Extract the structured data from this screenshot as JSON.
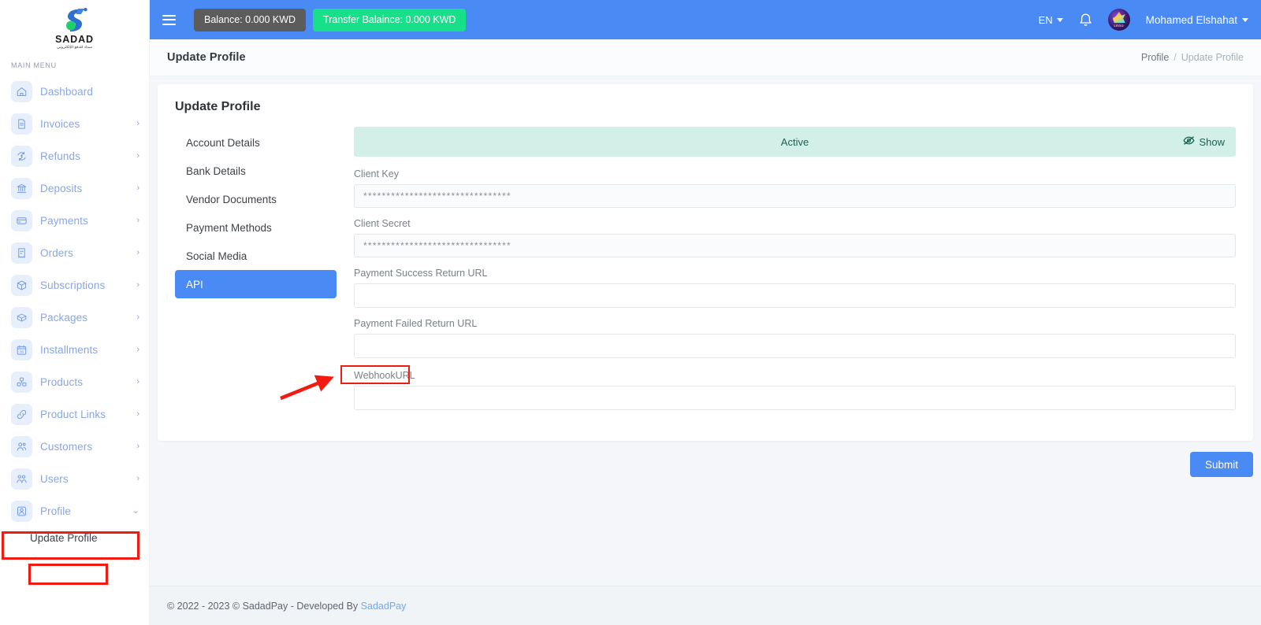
{
  "brand": {
    "logo_text": "SADAD",
    "logo_subtext": "سداد للدفع الإلكتروني"
  },
  "sidebar": {
    "section_label": "MAIN MENU",
    "items": [
      {
        "label": "Dashboard",
        "icon": "home-icon",
        "has_caret": false
      },
      {
        "label": "Invoices",
        "icon": "document-icon",
        "has_caret": true
      },
      {
        "label": "Refunds",
        "icon": "refund-icon",
        "has_caret": true
      },
      {
        "label": "Deposits",
        "icon": "bank-icon",
        "has_caret": true
      },
      {
        "label": "Payments",
        "icon": "credit-card-icon",
        "has_caret": true
      },
      {
        "label": "Orders",
        "icon": "receipt-icon",
        "has_caret": true
      },
      {
        "label": "Subscriptions",
        "icon": "box-icon",
        "has_caret": true
      },
      {
        "label": "Packages",
        "icon": "package-icon",
        "has_caret": true
      },
      {
        "label": "Installments",
        "icon": "calendar-30-icon",
        "has_caret": true
      },
      {
        "label": "Products",
        "icon": "products-icon",
        "has_caret": true
      },
      {
        "label": "Product Links",
        "icon": "link-icon",
        "has_caret": true
      },
      {
        "label": "Customers",
        "icon": "customers-icon",
        "has_caret": true
      },
      {
        "label": "Users",
        "icon": "users-icon",
        "has_caret": true
      },
      {
        "label": "Profile",
        "icon": "profile-icon",
        "has_caret": true,
        "expanded": true
      }
    ],
    "submenu": [
      {
        "label": "Update Profile",
        "active": true
      }
    ],
    "caret_glyph": "›",
    "caret_open_glyph": "⌄"
  },
  "topbar": {
    "balance_label": "Balance: 0.000 KWD",
    "transfer_label": "Transfer Balaince: 0.000 KWD",
    "language": "EN",
    "username": "Mohamed Elshahat",
    "avatar_tag": "LEGO",
    "icons": {
      "menu": "hamburger-icon",
      "bell": "notification-bell-icon"
    }
  },
  "pagehead": {
    "title": "Update Profile",
    "breadcrumb": {
      "parent": "Profile",
      "separator": "/",
      "current": "Update Profile"
    }
  },
  "card": {
    "title": "Update Profile",
    "tabs": [
      {
        "label": "Account Details",
        "active": false
      },
      {
        "label": "Bank Details",
        "active": false
      },
      {
        "label": "Vendor Documents",
        "active": false
      },
      {
        "label": "Payment Methods",
        "active": false
      },
      {
        "label": "Social Media",
        "active": false
      },
      {
        "label": "API",
        "active": true
      }
    ],
    "banner": {
      "status": "Active",
      "show_label": "Show",
      "show_icon": "eye-slash-icon"
    },
    "fields": [
      {
        "label": "Client Key",
        "value": "********************************",
        "masked": true,
        "placeholder": ""
      },
      {
        "label": "Client Secret",
        "value": "********************************",
        "masked": true,
        "placeholder": ""
      },
      {
        "label": "Payment Success Return URL",
        "value": "",
        "masked": false,
        "placeholder": ""
      },
      {
        "label": "Payment Failed Return URL",
        "value": "",
        "masked": false,
        "placeholder": ""
      },
      {
        "label": "WebhookURL",
        "value": "",
        "masked": false,
        "placeholder": "",
        "highlighted": true
      }
    ],
    "submit_label": "Submit"
  },
  "footer": {
    "text": "© 2022 - 2023 © SadadPay - Developed By",
    "link": "SadadPay"
  },
  "colors": {
    "primary": "#4a8af4",
    "success": "#18e08a",
    "banner_bg": "#d2f0e8",
    "banner_text": "#1d5f51",
    "balance_pill": "#5c5c5c",
    "annotation_red": "#f01c12",
    "sidebar_text": "#8aa6e2"
  }
}
